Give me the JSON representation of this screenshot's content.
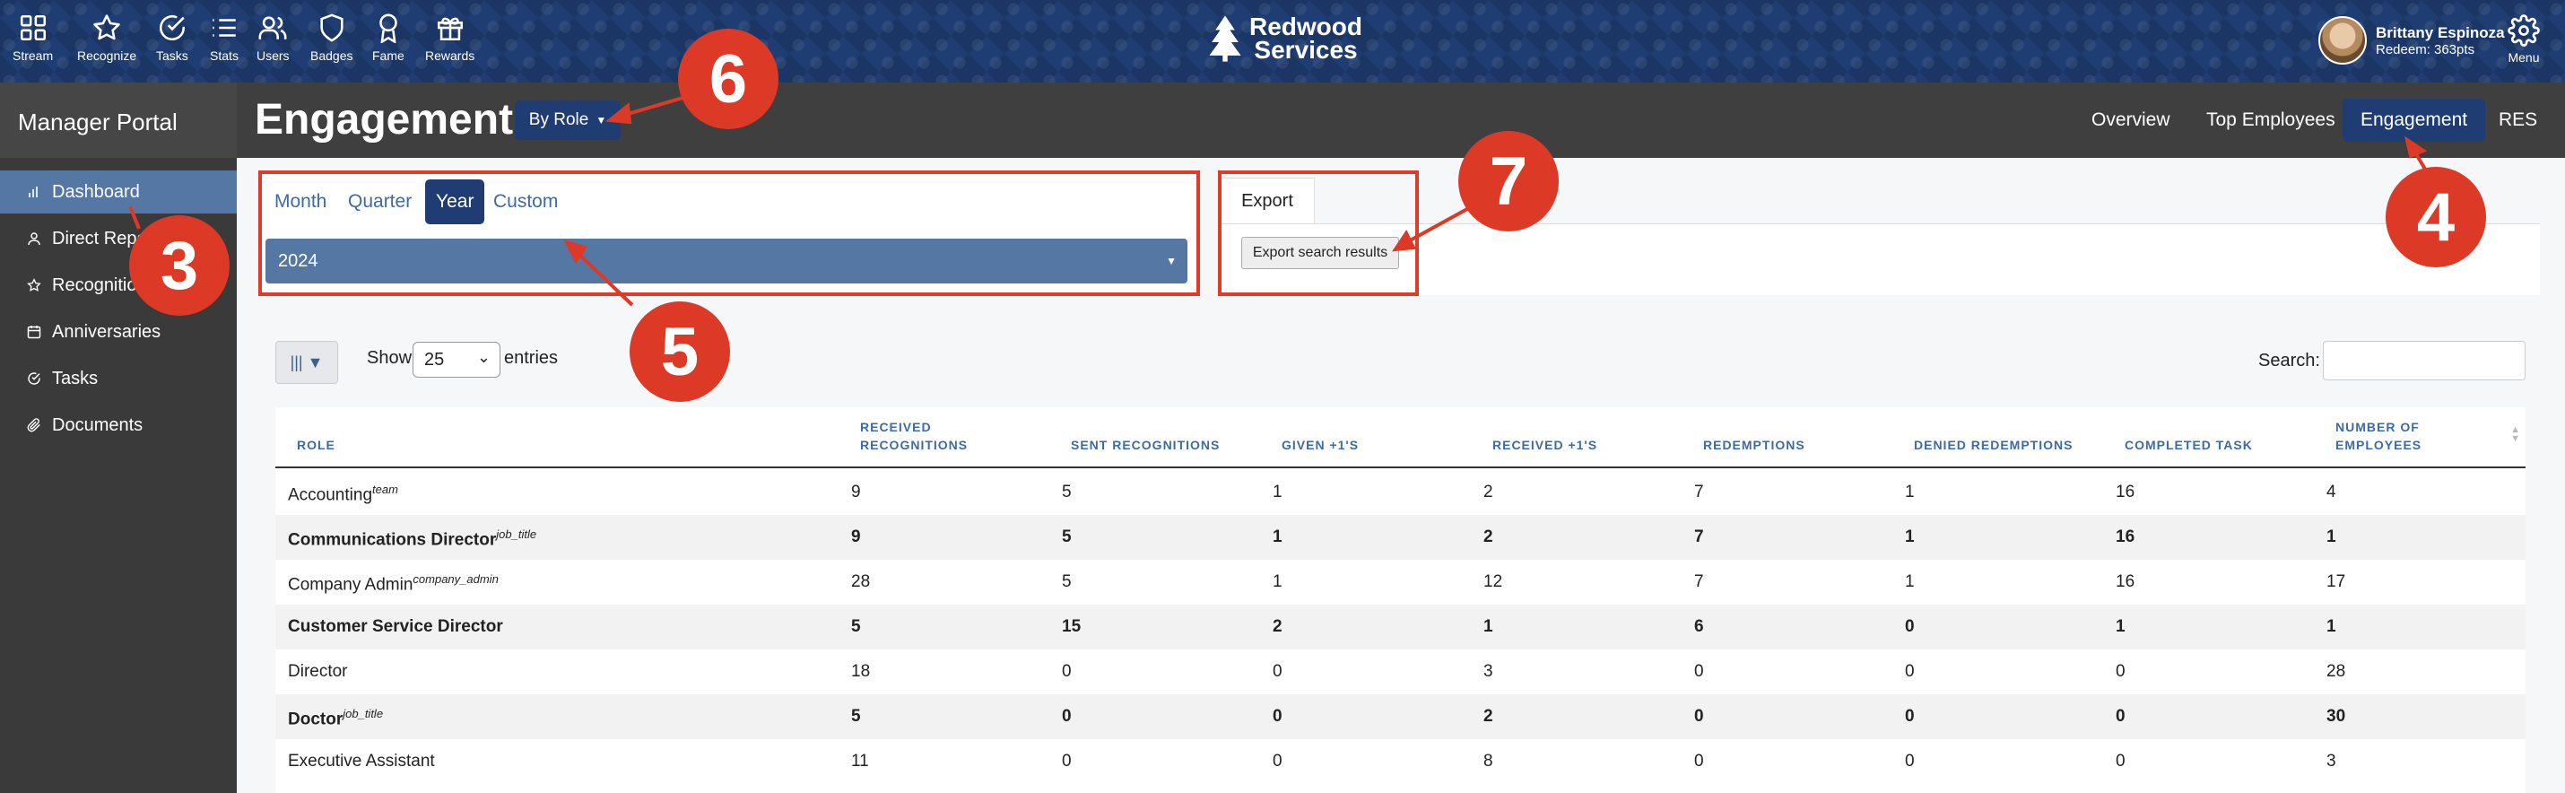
{
  "topnav": {
    "items": [
      {
        "label": "Stream",
        "icon": "grid-icon"
      },
      {
        "label": "Recognize",
        "icon": "star-icon"
      },
      {
        "label": "Tasks",
        "icon": "check-circle-icon"
      },
      {
        "label": "Stats",
        "icon": "list-icon"
      },
      {
        "label": "Users",
        "icon": "users-icon"
      },
      {
        "label": "Badges",
        "icon": "shield-icon"
      },
      {
        "label": "Fame",
        "icon": "award-icon"
      },
      {
        "label": "Rewards",
        "icon": "gift-icon"
      }
    ],
    "brand_line1": "Redwood",
    "brand_line2": "Services",
    "user_name": "Brittany Espinoza",
    "user_points": "Redeem: 363pts",
    "menu_label": "Menu"
  },
  "header": {
    "portal": "Manager Portal",
    "title": "Engagement",
    "by_role": "By Role",
    "tabs": [
      "Overview",
      "Top Employees",
      "Engagement",
      "RES"
    ],
    "active_tab": "Engagement"
  },
  "sidebar": {
    "items": [
      {
        "label": "Dashboard",
        "icon": "bar-chart-icon"
      },
      {
        "label": "Direct Reports",
        "icon": "person-icon"
      },
      {
        "label": "Recognitions",
        "icon": "star-icon"
      },
      {
        "label": "Anniversaries",
        "icon": "calendar-icon"
      },
      {
        "label": "Tasks",
        "icon": "check-circle-icon"
      },
      {
        "label": "Documents",
        "icon": "paperclip-icon"
      }
    ]
  },
  "filters": {
    "periods": [
      "Month",
      "Quarter",
      "Year",
      "Custom"
    ],
    "active_period": "Year",
    "year_value": "2024"
  },
  "export": {
    "tab_label": "Export",
    "button_label": "Export search results"
  },
  "table_controls": {
    "show_label": "Show",
    "page_length": "25",
    "entries_label": "entries",
    "search_label": "Search:"
  },
  "table": {
    "columns": [
      "Role",
      "Received Recognitions",
      "Sent Recognitions",
      "Given +1's",
      "Received +1's",
      "Redemptions",
      "Denied Redemptions",
      "Completed Task",
      "Number of Employees"
    ],
    "rows": [
      {
        "role": "Accounting",
        "tag": "team",
        "values": [
          "9",
          "5",
          "1",
          "2",
          "7",
          "1",
          "16",
          "4"
        ]
      },
      {
        "role": "Communications Director",
        "tag": "job_title",
        "values": [
          "9",
          "5",
          "1",
          "2",
          "7",
          "1",
          "16",
          "1"
        ]
      },
      {
        "role": "Company Admin",
        "tag": "company_admin",
        "values": [
          "28",
          "5",
          "1",
          "12",
          "7",
          "1",
          "16",
          "17"
        ]
      },
      {
        "role": "Customer Service Director",
        "tag": "",
        "values": [
          "5",
          "15",
          "2",
          "1",
          "6",
          "0",
          "1",
          "1"
        ]
      },
      {
        "role": "Director",
        "tag": "",
        "values": [
          "18",
          "0",
          "0",
          "3",
          "0",
          "0",
          "0",
          "28"
        ]
      },
      {
        "role": "Doctor",
        "tag": "job_title",
        "values": [
          "5",
          "0",
          "0",
          "2",
          "0",
          "0",
          "0",
          "30"
        ]
      },
      {
        "role": "Executive Assistant",
        "tag": "",
        "values": [
          "11",
          "0",
          "0",
          "8",
          "0",
          "0",
          "0",
          "3"
        ]
      }
    ]
  },
  "annotations": [
    "3",
    "4",
    "5",
    "6",
    "7"
  ],
  "colors": {
    "accent": "#1f3d72",
    "sidebar_active": "#5577a4",
    "annotation": "#dc3a26"
  }
}
